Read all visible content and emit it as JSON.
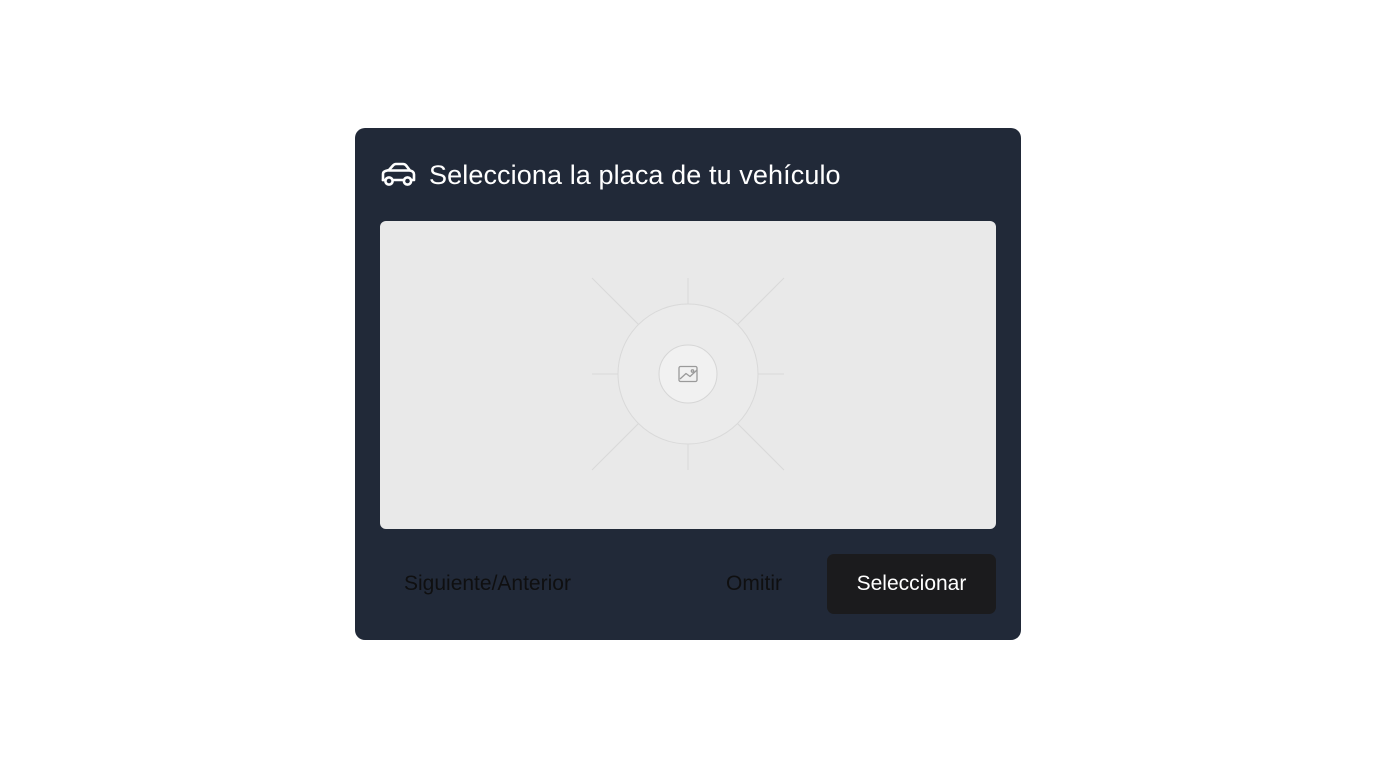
{
  "dialog": {
    "title": "Selecciona la placa de tu vehículo",
    "title_icon": "car-icon",
    "image_placeholder_icon": "image-icon"
  },
  "actions": {
    "navigate_label": "Siguiente/Anterior",
    "skip_label": "Omitir",
    "select_label": "Seleccionar"
  },
  "colors": {
    "dialog_background": "#212938",
    "image_area_background": "#e9e9e9",
    "primary_button_background": "#1b1b1d",
    "title_text": "#ffffff"
  }
}
